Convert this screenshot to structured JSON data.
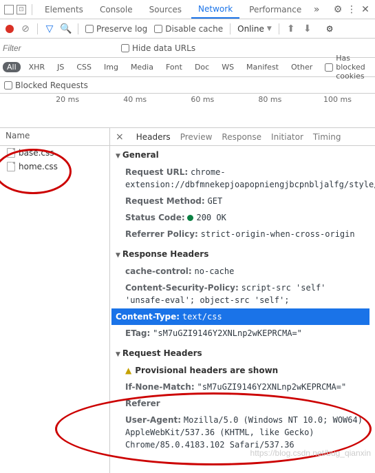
{
  "topTabs": {
    "t1": "Elements",
    "t2": "Console",
    "t3": "Sources",
    "t4": "Network",
    "t5": "Performance"
  },
  "toolbar": {
    "preserve": "Preserve log",
    "disable": "Disable cache",
    "online": "Online"
  },
  "filter": {
    "placeholder": "Filter",
    "hide": "Hide data URLs"
  },
  "types": {
    "all": "All",
    "xhr": "XHR",
    "js": "JS",
    "css": "CSS",
    "img": "Img",
    "media": "Media",
    "font": "Font",
    "doc": "Doc",
    "ws": "WS",
    "manifest": "Manifest",
    "other": "Other",
    "blocked": "Has blocked cookies"
  },
  "blocked": {
    "label": "Blocked Requests"
  },
  "timeline": {
    "t1": "20 ms",
    "t2": "40 ms",
    "t3": "60 ms",
    "t4": "80 ms",
    "t5": "100 ms"
  },
  "names": {
    "hdr": "Name",
    "f1": "base.css",
    "f2": "home.css"
  },
  "detailTabs": {
    "headers": "Headers",
    "preview": "Preview",
    "response": "Response",
    "initiator": "Initiator",
    "timing": "Timing"
  },
  "general": {
    "title": "General",
    "url_k": "Request URL:",
    "url_v": "chrome-extension://dbfmnekepjoapopniengjbcpnbljalfg/style/base.css",
    "method_k": "Request Method:",
    "method_v": "GET",
    "status_k": "Status Code:",
    "status_v": "200 OK",
    "ref_k": "Referrer Policy:",
    "ref_v": "strict-origin-when-cross-origin"
  },
  "resp": {
    "title": "Response Headers",
    "cc_k": "cache-control:",
    "cc_v": "no-cache",
    "csp_k": "Content-Security-Policy:",
    "csp_v": "script-src 'self' 'unsafe-eval'; object-src 'self';",
    "ct_k": "Content-Type:",
    "ct_v": "text/css",
    "et_k": "ETag:",
    "et_v": "\"sM7uGZI9146Y2XNLnp2wKEPRCMA=\""
  },
  "req": {
    "title": "Request Headers",
    "prov": "Provisional headers are shown",
    "inm_k": "If-None-Match:",
    "inm_v": "\"sM7uGZI9146Y2XNLnp2wKEPRCMA=\"",
    "ref_k": "Referer",
    "ua_k": "User-Agent:",
    "ua_v": "Mozilla/5.0 (Windows NT 10.0; WOW64) AppleWebKit/537.36 (KHTML, like Gecko) Chrome/85.0.4183.102 Safari/537.36"
  },
  "watermark": "https://blog.csdn.net/bug_qianxin"
}
